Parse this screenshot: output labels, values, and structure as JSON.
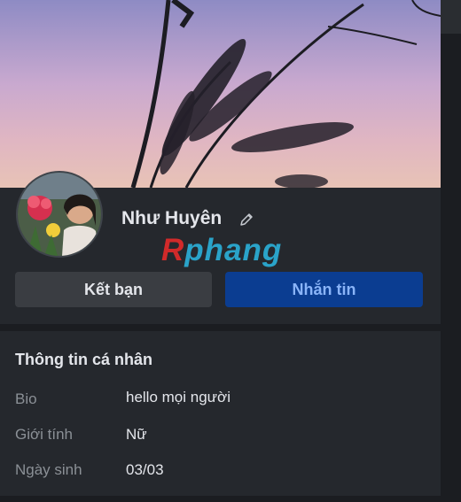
{
  "profile": {
    "name": "Như Huyên",
    "edit_icon": "pencil-icon"
  },
  "watermark": {
    "part1": "R",
    "part2": "phang"
  },
  "actions": {
    "friend_label": "Kết bạn",
    "message_label": "Nhắn tin"
  },
  "personal_info": {
    "title": "Thông tin cá nhân",
    "rows": [
      {
        "label": "Bio",
        "value": "hello mọi người"
      },
      {
        "label": "Giới tính",
        "value": "Nữ"
      },
      {
        "label": "Ngày sinh",
        "value": "03/03"
      }
    ]
  },
  "colors": {
    "panel_bg": "#25282d",
    "accent_button": "#0b3d91",
    "accent_text": "#8ab4f8",
    "secondary_button": "#3a3d42"
  }
}
